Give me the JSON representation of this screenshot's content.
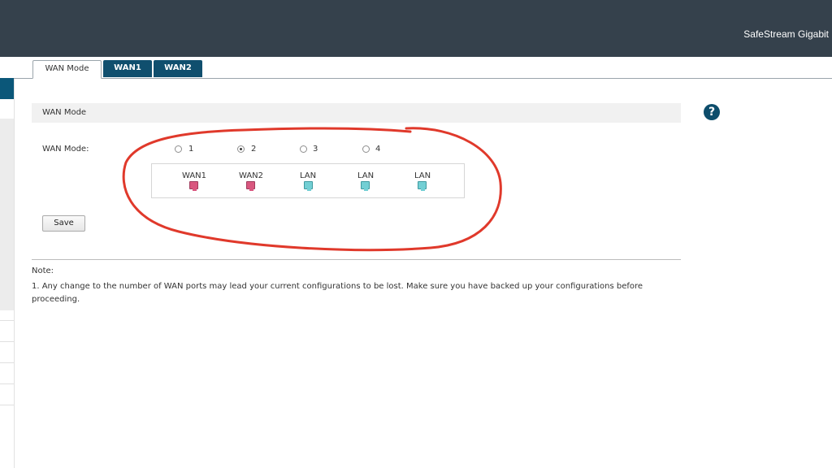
{
  "header": {
    "brand": "SafeStream Gigabit"
  },
  "tabs": [
    {
      "label": "WAN Mode",
      "active": true
    },
    {
      "label": "WAN1",
      "active": false
    },
    {
      "label": "WAN2",
      "active": false
    }
  ],
  "section": {
    "title": "WAN Mode"
  },
  "help_icon": "question-circle-icon",
  "form": {
    "wan_mode_label": "WAN Mode:",
    "options": [
      "1",
      "2",
      "3",
      "4"
    ],
    "selected": "2",
    "ports": [
      {
        "label": "WAN1",
        "type": "wan"
      },
      {
        "label": "WAN2",
        "type": "wan"
      },
      {
        "label": "LAN",
        "type": "lan"
      },
      {
        "label": "LAN",
        "type": "lan"
      },
      {
        "label": "LAN",
        "type": "lan"
      }
    ],
    "save_label": "Save"
  },
  "note": {
    "title": "Note:",
    "text": "1. Any change to the number of WAN ports may lead your current configurations to be lost. Make sure you have backed up your configurations before proceeding."
  },
  "colors": {
    "header_bg": "#35414c",
    "tab_active_bg": "#104f6e",
    "wan_port": "#d9577f",
    "lan_port": "#73cfd4",
    "annotation": "#e0392b"
  }
}
